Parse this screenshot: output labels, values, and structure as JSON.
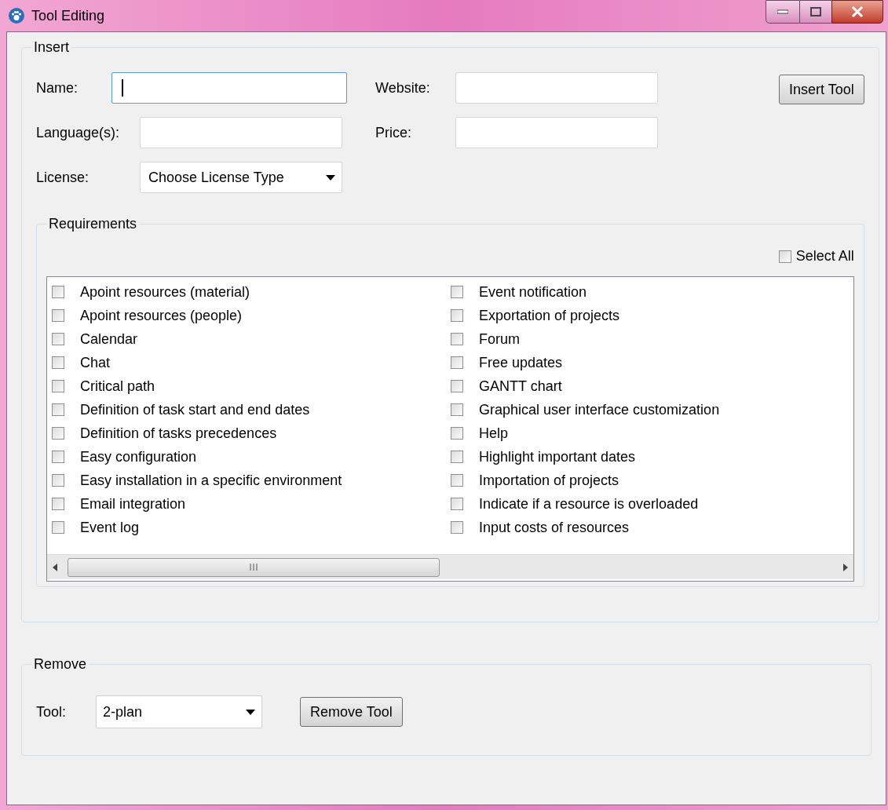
{
  "window": {
    "title": "Tool Editing"
  },
  "insert": {
    "legend": "Insert",
    "fields": [
      {
        "label": "Name:",
        "focused": true
      },
      {
        "label": "Website:",
        "focused": false
      },
      {
        "label": "Language(s):",
        "focused": false
      },
      {
        "label": "Price:",
        "focused": false
      }
    ],
    "license": {
      "label": "License:",
      "value": "Choose License Type"
    },
    "button": "Insert Tool",
    "requirements": {
      "legend": "Requirements",
      "select_all": {
        "label": "Select All",
        "checked": false
      },
      "items": [
        {
          "label": "Apoint resources (material)",
          "checked": false
        },
        {
          "label": "Apoint resources (people)",
          "checked": false
        },
        {
          "label": "Calendar",
          "checked": false
        },
        {
          "label": "Chat",
          "checked": false
        },
        {
          "label": "Critical path",
          "checked": false
        },
        {
          "label": "Definition of task start and end dates",
          "checked": false
        },
        {
          "label": "Definition of tasks precedences",
          "checked": false
        },
        {
          "label": "Easy configuration",
          "checked": false
        },
        {
          "label": "Easy installation in a specific environment",
          "checked": false
        },
        {
          "label": "Email integration",
          "checked": false
        },
        {
          "label": "Event log",
          "checked": false
        },
        {
          "label": "Event notification",
          "checked": false
        },
        {
          "label": "Exportation of projects",
          "checked": false
        },
        {
          "label": "Forum",
          "checked": false
        },
        {
          "label": "Free updates",
          "checked": false
        },
        {
          "label": "GANTT chart",
          "checked": false
        },
        {
          "label": "Graphical user interface customization",
          "checked": false
        },
        {
          "label": "Help",
          "checked": false
        },
        {
          "label": "Highlight important dates",
          "checked": false
        },
        {
          "label": "Importation of projects",
          "checked": false
        },
        {
          "label": "Indicate if a resource is overloaded",
          "checked": false
        },
        {
          "label": "Input costs of resources",
          "checked": false
        }
      ]
    }
  },
  "remove": {
    "legend": "Remove",
    "tool": {
      "label": "Tool:",
      "value": "2-plan"
    },
    "button": "Remove Tool"
  }
}
